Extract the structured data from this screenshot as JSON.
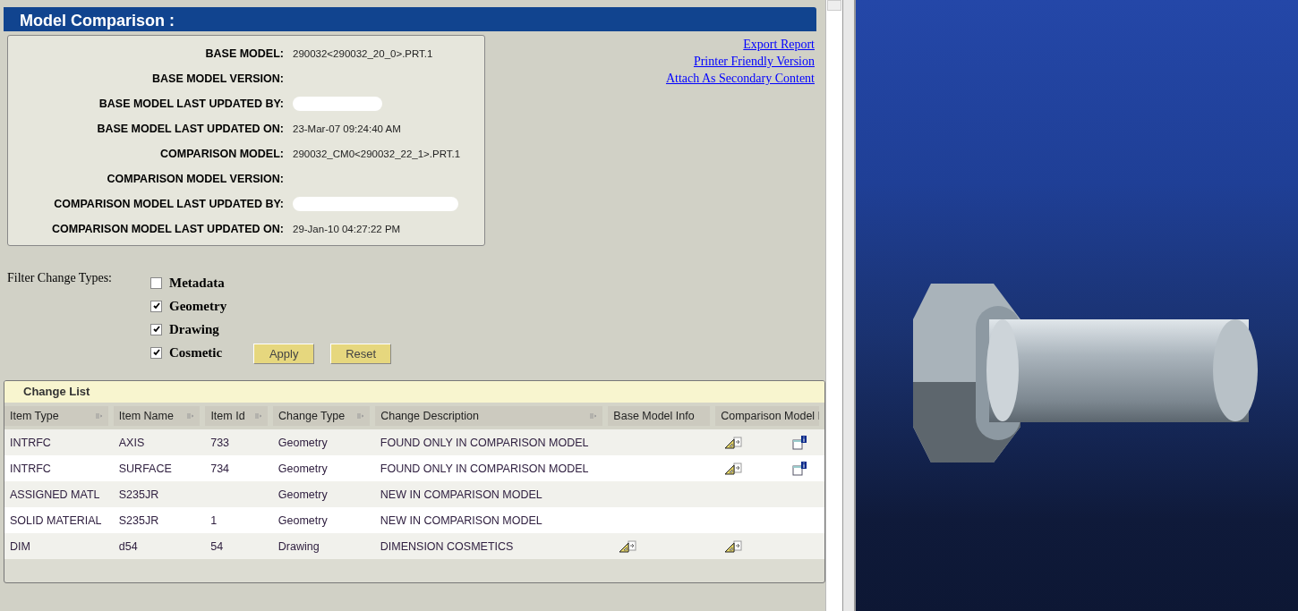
{
  "header": {
    "title": "Model Comparison :"
  },
  "model_info": [
    {
      "label": "BASE MODEL:",
      "value": "290032<290032_20_0>.PRT.1",
      "redacted": false
    },
    {
      "label": "BASE MODEL VERSION:",
      "redacted": false
    },
    {
      "label": "BASE MODEL LAST UPDATED BY:",
      "redacted": true
    },
    {
      "label": "BASE MODEL LAST UPDATED ON:",
      "value": "23-Mar-07 09:24:40 AM",
      "redacted": false
    },
    {
      "label": "COMPARISON MODEL:",
      "value": "290032_CM0<290032_22_1>.PRT.1",
      "redacted": false
    },
    {
      "label": "COMPARISON MODEL VERSION:",
      "redacted": false
    },
    {
      "label": "COMPARISON MODEL LAST UPDATED BY:",
      "redacted": true
    },
    {
      "label": "COMPARISON MODEL LAST UPDATED ON:",
      "value": "29-Jan-10 04:27:22 PM",
      "redacted": false
    }
  ],
  "links": [
    "Export Report",
    "Printer Friendly Version",
    "Attach As Secondary Content"
  ],
  "filter": {
    "label": "Filter Change Types:",
    "options": [
      {
        "label": "Metadata",
        "checked": false
      },
      {
        "label": "Geometry",
        "checked": true
      },
      {
        "label": "Drawing",
        "checked": true
      },
      {
        "label": "Cosmetic",
        "checked": true
      }
    ],
    "buttons": [
      "Apply",
      "Reset"
    ]
  },
  "change_list": {
    "title": "Change List",
    "columns": [
      {
        "label": "Item Type",
        "sortable": true
      },
      {
        "label": "Item Name",
        "sortable": true
      },
      {
        "label": "Item Id",
        "sortable": true
      },
      {
        "label": "Change Type",
        "sortable": true
      },
      {
        "label": "Change Description",
        "sortable": true
      },
      {
        "label": "Base Model Info",
        "sortable": false
      },
      {
        "label": "Comparison Model I",
        "sortable": false
      }
    ],
    "rows": [
      {
        "item_type": "INTRFC",
        "item_name": "AXIS",
        "item_id": "733",
        "change_type": "Geometry",
        "change_description": "FOUND ONLY IN COMPARISON MODEL",
        "base_info": false,
        "comparison_info": true,
        "details": true
      },
      {
        "item_type": "INTRFC",
        "item_name": "SURFACE",
        "item_id": "734",
        "change_type": "Geometry",
        "change_description": "FOUND ONLY IN COMPARISON MODEL",
        "base_info": false,
        "comparison_info": true,
        "details": true
      },
      {
        "item_type": "ASSIGNED MATL",
        "item_name": "S235JR",
        "change_type": "Geometry",
        "change_description": "NEW IN COMPARISON MODEL",
        "base_info": false,
        "comparison_info": false,
        "details": false
      },
      {
        "item_type": "SOLID MATERIAL",
        "item_name": "S235JR",
        "item_id": "1",
        "change_type": "Geometry",
        "change_description": "NEW IN COMPARISON MODEL",
        "base_info": false,
        "comparison_info": false,
        "details": false
      },
      {
        "item_type": "DIM",
        "item_name": "d54",
        "item_id": "54",
        "change_type": "Drawing",
        "change_description": "DIMENSION COSMETICS",
        "base_info": true,
        "comparison_info": true,
        "details": false
      }
    ]
  }
}
